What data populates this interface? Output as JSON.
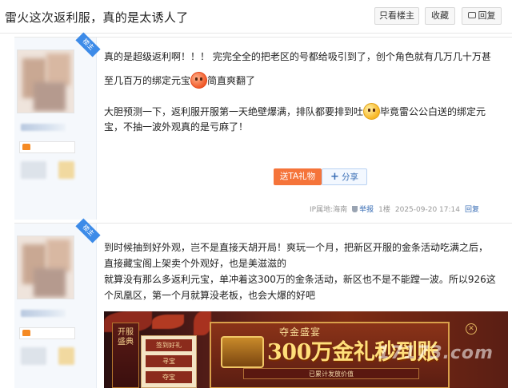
{
  "header": {
    "title": "雷火这次返利服，真的是太诱人了",
    "only_op_label": "只看楼主",
    "favorite_label": "收藏",
    "reply_label": "回复",
    "reply_icon": "comment-icon"
  },
  "posts": [
    {
      "badge": "楼主",
      "paragraphs": [
        {
          "before": "真的是超级返利啊！！！ 完完全全的把老区的号都给吸引到了，创个角色就有几万几十万甚"
        },
        {
          "before": "至几百万的绑定元宝",
          "emoji": "laughing-emoji-icon",
          "after": "简直爽翻了"
        },
        {
          "before": "大胆预测一下，返利服开服第一天绝壁爆满，排队都要排到吐",
          "emoji": "tongue-emoji-icon",
          "after": "毕竟雷公公白送的绑定元"
        },
        {
          "before": "宝，不抽一波外观真的是亏麻了！"
        }
      ],
      "gift_label": "送TA礼物",
      "share_label": "分享",
      "ip_location": "IP属地:海南",
      "report_label": "举报",
      "floor": "1楼",
      "time": "2025-09-20 17:14",
      "reply_count": "回复"
    },
    {
      "badge": "楼主",
      "paragraphs": [
        {
          "before": "到时候抽到好外观，岂不是直接天胡开局！爽玩一个月，把新区开服的金条活动吃满之后，"
        },
        {
          "before": "直接藏宝阁上架卖个外观好，也是美滋滋的"
        },
        {
          "before": "就算没有那么多返利元宝，单冲着这300万的金条活动，新区也不是不能蹚一波。所以926这"
        },
        {
          "before": "个凤凰区，第一个月就算没老板，也会大爆的好吧"
        }
      ],
      "banner": {
        "subtitle": "夺金盛宴",
        "headline": "300万金礼秒到账",
        "strip": "已累计发放价值",
        "side_title": "开服盛典",
        "menu_items": [
          "签到好礼",
          "寻宝",
          "夺宝"
        ],
        "watermark": "17173.com"
      }
    }
  ],
  "colors": {
    "accent": "#f5743a",
    "link": "#3b6fb6",
    "badge": "#3d8be8"
  }
}
